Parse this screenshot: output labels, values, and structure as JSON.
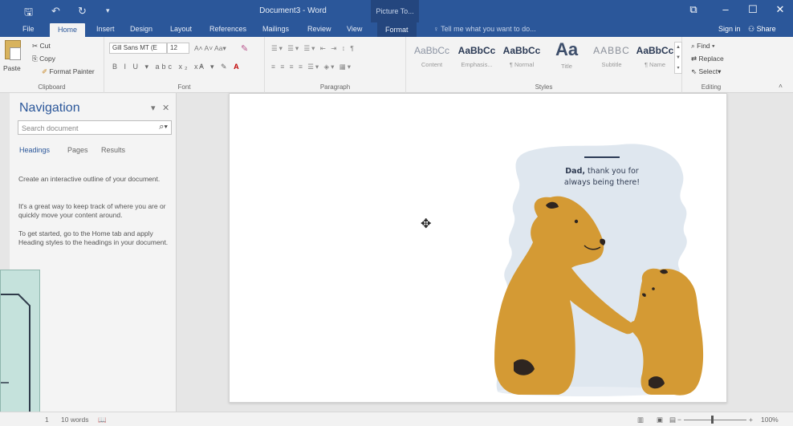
{
  "window": {
    "title": "Document3 - Word",
    "contextual_group": "Picture To...",
    "controls": [
      "⧉",
      "–",
      "☐",
      "✕"
    ]
  },
  "quick_access": {
    "save": "🖫",
    "undo": "↶",
    "redo": "↻",
    "customize": "▾"
  },
  "tabs": [
    {
      "label": "File"
    },
    {
      "label": "Home"
    },
    {
      "label": "Insert"
    },
    {
      "label": "Design"
    },
    {
      "label": "Layout"
    },
    {
      "label": "References"
    },
    {
      "label": "Mailings"
    },
    {
      "label": "Review"
    },
    {
      "label": "View"
    },
    {
      "label": "Format"
    }
  ],
  "tell_me": "Tell me what you want to do...",
  "account": {
    "sign_in": "Sign in",
    "share": "Share"
  },
  "ribbon": {
    "clipboard": {
      "paste": "Paste",
      "cut": "Cut",
      "copy": "Copy",
      "format_painter": "Format Painter",
      "label": "Clipboard"
    },
    "font": {
      "name": "Gill Sans MT (E",
      "size": "12",
      "label": "Font"
    },
    "paragraph": {
      "label": "Paragraph"
    },
    "styles": {
      "label": "Styles",
      "items": [
        {
          "sample": "AaBbCc",
          "name": "Content"
        },
        {
          "sample": "AaBbCc",
          "name": "Emphasis..."
        },
        {
          "sample": "AaBbCc",
          "name": "¶ Normal"
        },
        {
          "sample": "Aa",
          "name": "Title"
        },
        {
          "sample": "AABBC",
          "name": "Subtitle"
        },
        {
          "sample": "AaBbCc",
          "name": "¶ Name"
        }
      ]
    },
    "editing": {
      "find": "Find",
      "replace": "Replace",
      "select": "Select",
      "label": "Editing"
    }
  },
  "navigation": {
    "title": "Navigation",
    "search_placeholder": "Search document",
    "tabs": [
      {
        "label": "Headings"
      },
      {
        "label": "Pages"
      },
      {
        "label": "Results"
      }
    ],
    "paragraphs": [
      "Create an interactive outline of your document.",
      "It's a great way to keep track of where you are or quickly move your content around.",
      "To get started, go to the Home tab and apply Heading styles to the headings in your document."
    ]
  },
  "document": {
    "card_bold": "Dad,",
    "card_rest": " thank you for always being there!"
  },
  "status": {
    "page": "1",
    "words": "10 words",
    "zoom": "100%"
  },
  "colors": {
    "word_blue": "#2b579a",
    "bear": "#d49a34",
    "bear_shadow": "#b97f22",
    "splash": "#dfe7ef"
  }
}
